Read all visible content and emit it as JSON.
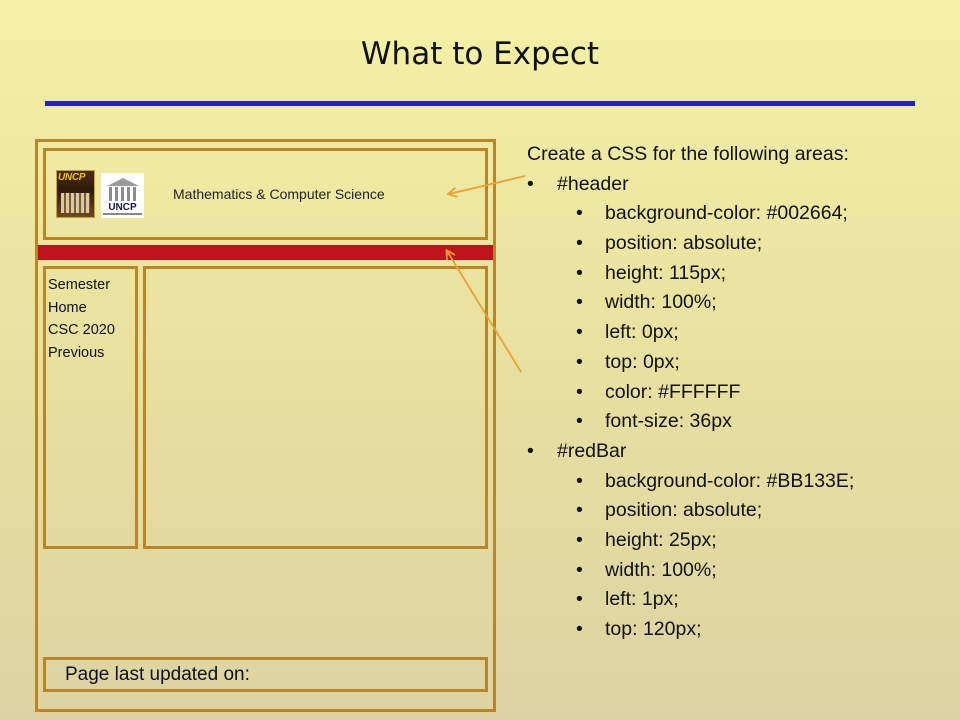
{
  "slide": {
    "title": "What to Expect"
  },
  "mockup": {
    "logo1_text": "UNCP",
    "logo2_text": "UNCP",
    "header_text": "Mathematics & Computer Science",
    "nav_items": [
      "Semester",
      "Home",
      "CSC 2020",
      "Previous"
    ],
    "footer_text": "Page last updated on:"
  },
  "notes": {
    "intro": "Create a CSS for the following areas:",
    "sections": [
      {
        "selector": "#header",
        "rules": [
          "background-color: #002664;",
          "position: absolute;",
          "height: 115px;",
          "width: 100%;",
          "left: 0px;",
          "top: 0px;",
          "color: #FFFFFF",
          "font-size: 36px"
        ]
      },
      {
        "selector": "#redBar",
        "rules": [
          "background-color: #BB133E;",
          "position: absolute;",
          "height: 25px;",
          "width: 100%;",
          "left: 1px;",
          "top: 120px;"
        ]
      }
    ]
  },
  "colors": {
    "title_rule": "#2222c4",
    "box_border": "#b98527",
    "red_bar": "#c0121b",
    "arrow": "#f0a030"
  }
}
